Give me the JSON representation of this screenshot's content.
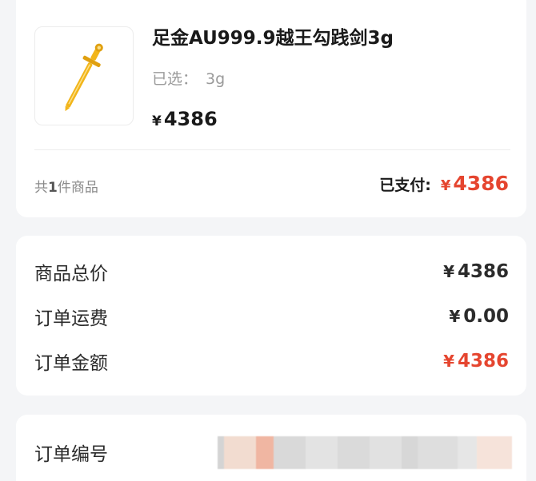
{
  "product": {
    "title": "足金AU999.9越王勾践剑3g",
    "spec_label": "已选：",
    "spec_value": "3g",
    "currency": "¥",
    "price": "4386",
    "thumb_icon": "gold-sword-icon"
  },
  "footer": {
    "count_prefix": "共",
    "count_num": "1",
    "count_suffix": "件商品",
    "paid_label": "已支付:",
    "currency": "¥",
    "paid_amount": "4386"
  },
  "summary": {
    "rows": [
      {
        "label": "商品总价",
        "currency": "¥",
        "value": "4386"
      },
      {
        "label": "订单运费",
        "currency": "¥",
        "value": "0.00"
      },
      {
        "label": "订单金额",
        "currency": "¥",
        "value": "4386"
      }
    ]
  },
  "order": {
    "number_label": "订单编号"
  },
  "colors": {
    "accent_red": "#e5452f",
    "background": "#f4f5f7",
    "gold": "#f2b51a"
  }
}
